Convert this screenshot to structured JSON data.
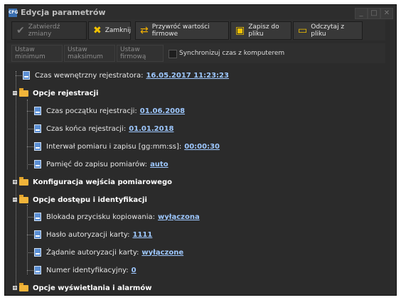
{
  "window": {
    "title": "Edycja parametrów",
    "icon_label": "CFG"
  },
  "toolbar": {
    "confirm": "Zatwierdź zmiany",
    "close": "Zamknij",
    "restore": "Przywróć wartości firmowe",
    "save_file": "Zapisz do pliku",
    "read_file": "Odczytaj z pliku"
  },
  "toolbar2": {
    "set_min": "Ustaw minimum",
    "set_max": "Ustaw maksimum",
    "set_factory": "Ustaw firmową",
    "sync_label": "Synchronizuj czas z komputerem"
  },
  "tree": {
    "internal_time": {
      "label": "Czas wewnętrzny rejestratora:",
      "value": "16.05.2017 11:23:23"
    },
    "reg_options": {
      "label": "Opcje rejestracji",
      "start": {
        "label": "Czas początku rejestracji:",
        "value": "01.06.2008"
      },
      "end": {
        "label": "Czas końca rejestracji:",
        "value": "01.01.2018"
      },
      "interval": {
        "label": "Interwał pomiaru i zapisu [gg:mm:ss]:",
        "value": "00:00:30"
      },
      "memory": {
        "label": "Pamięć do zapisu pomiarów:",
        "value": "auto"
      }
    },
    "input_config": {
      "label": "Konfiguracja wejścia pomiarowego"
    },
    "access": {
      "label": "Opcje dostępu i identyfikacji",
      "copy_lock": {
        "label": "Blokada przycisku kopiowania:",
        "value": "wyłączona"
      },
      "card_password": {
        "label": "Hasło autoryzacji karty:",
        "value": "1111"
      },
      "card_auth": {
        "label": "Żądanie autoryzacji karty:",
        "value": "wyłączone"
      },
      "id_number": {
        "label": "Numer identyfikacyjny:",
        "value": "0"
      }
    },
    "display": {
      "label": "Opcje wyświetlania i alarmów"
    }
  }
}
